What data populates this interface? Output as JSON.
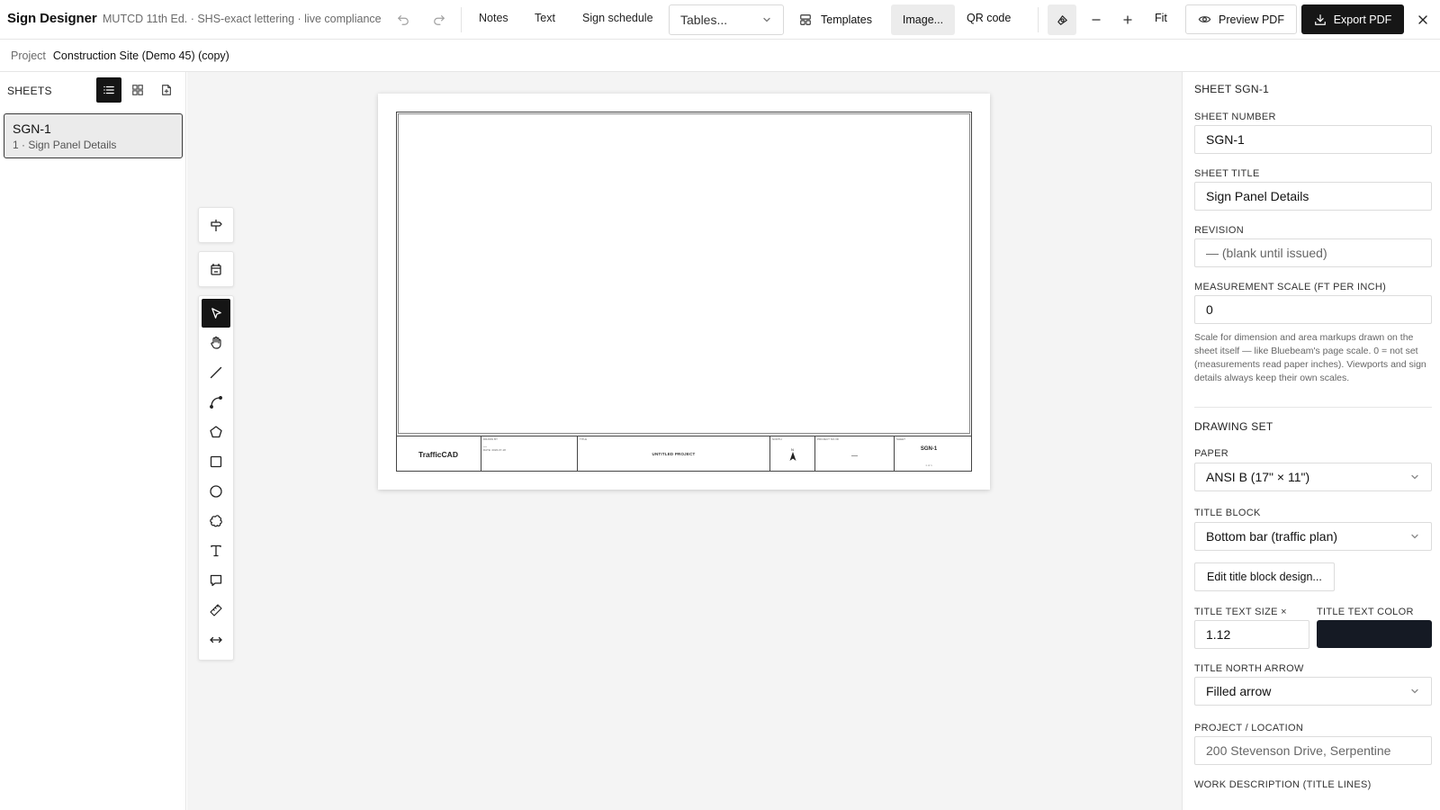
{
  "app": {
    "title": "Sign Designer",
    "subtitle": "MUTCD 11th Ed. · SHS-exact lettering · live compliance"
  },
  "toolbar": {
    "notes": "Notes",
    "text": "Text",
    "sign_schedule": "Sign schedule",
    "tables": "Tables...",
    "templates": "Templates",
    "image": "Image...",
    "qr_code": "QR code",
    "fit": "Fit",
    "preview_pdf": "Preview PDF",
    "export_pdf": "Export PDF"
  },
  "project": {
    "label": "Project",
    "name": "Construction Site (Demo 45) (copy)"
  },
  "sidebar": {
    "header": "SHEETS",
    "sheets": [
      {
        "number": "SGN-1",
        "title": "1 · Sign Panel Details"
      }
    ]
  },
  "titleblock": {
    "logo": "TrafficCAD",
    "drawn_by": "DRAWN BY",
    "drawn_date": "DATE: 2026-07-18",
    "title_label": "TITLE",
    "project_name": "UNTITLED PROJECT",
    "north_label": "NORTH",
    "north_letter": "N",
    "project_no_label": "PROJECT NO./ID",
    "project_no": "—",
    "sheet_label": "SHEET",
    "sheet_no": "SGN-1",
    "sheet_of": "1 of 1"
  },
  "panel": {
    "heading": "SHEET SGN-1",
    "sheet_number_label": "SHEET NUMBER",
    "sheet_number": "SGN-1",
    "sheet_title_label": "SHEET TITLE",
    "sheet_title": "Sign Panel Details",
    "revision_label": "REVISION",
    "revision": "— (blank until issued)",
    "scale_label": "MEASUREMENT SCALE (FT PER INCH)",
    "scale": "0",
    "scale_help": "Scale for dimension and area markups drawn on the sheet itself — like Bluebeam's page scale. 0 = not set (measurements read paper inches). Viewports and sign details always keep their own scales.",
    "drawing_set_heading": "DRAWING SET",
    "paper_label": "PAPER",
    "paper": "ANSI B (17\" × 11\")",
    "title_block_label": "TITLE BLOCK",
    "title_block": "Bottom bar (traffic plan)",
    "edit_title_block": "Edit title block design...",
    "title_text_size_label": "TITLE TEXT SIZE ×",
    "title_text_size": "1.12",
    "title_text_color_label": "TITLE TEXT COLOR",
    "title_text_color": "#151a24",
    "north_arrow_label": "TITLE NORTH ARROW",
    "north_arrow": "Filled arrow",
    "location_label": "PROJECT / LOCATION",
    "location": "200 Stevenson Drive, Serpentine",
    "work_desc_label": "WORK DESCRIPTION (TITLE LINES)"
  },
  "icons": {
    "undo": "undo-icon",
    "redo": "redo-icon",
    "templates": "templates-icon",
    "snap": "snap-icon",
    "zoom_out": "minus-icon",
    "zoom_in": "plus-icon",
    "preview": "eye-icon",
    "export": "download-icon",
    "close": "close-icon"
  }
}
